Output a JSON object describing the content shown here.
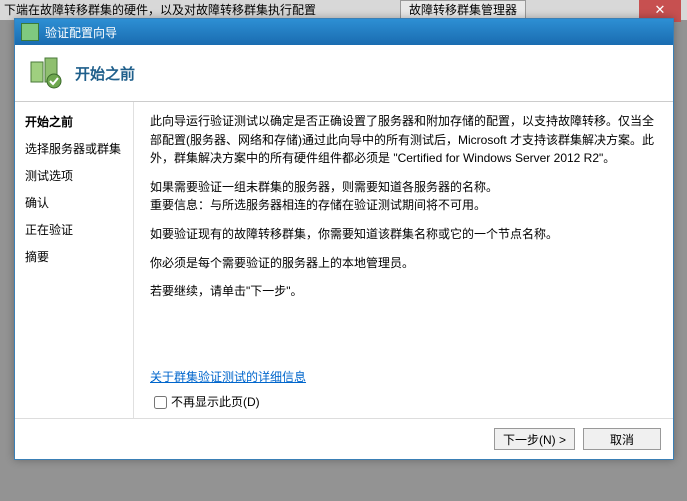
{
  "background": {
    "strip_text": "下端在故障转移群集的硬件，以及对故障转移群集执行配置",
    "tab_text": "故障转移群集管理器"
  },
  "titlebar": {
    "text": "验证配置向导"
  },
  "header": {
    "title": "开始之前"
  },
  "sidebar": {
    "items": [
      {
        "label": "开始之前",
        "active": true
      },
      {
        "label": "选择服务器或群集",
        "active": false
      },
      {
        "label": "测试选项",
        "active": false
      },
      {
        "label": "确认",
        "active": false
      },
      {
        "label": "正在验证",
        "active": false
      },
      {
        "label": "摘要",
        "active": false
      }
    ]
  },
  "content": {
    "p1": "此向导运行验证测试以确定是否正确设置了服务器和附加存储的配置，以支持故障转移。仅当全部配置(服务器、网络和存储)通过此向导中的所有测试后，Microsoft 才支持该群集解决方案。此外，群集解决方案中的所有硬件组件都必须是 \"Certified for Windows Server 2012 R2\"。",
    "p2a": "如果需要验证一组未群集的服务器，则需要知道各服务器的名称。",
    "p2b": "重要信息：与所选服务器相连的存储在验证测试期间将不可用。",
    "p3": "如要验证现有的故障转移群集，你需要知道该群集名称或它的一个节点名称。",
    "p4": "你必须是每个需要验证的服务器上的本地管理员。",
    "p5": "若要继续，请单击\"下一步\"。",
    "link": "关于群集验证测试的详细信息",
    "checkbox": "不再显示此页(D)"
  },
  "buttons": {
    "next": "下一步(N) >",
    "cancel": "取消"
  }
}
